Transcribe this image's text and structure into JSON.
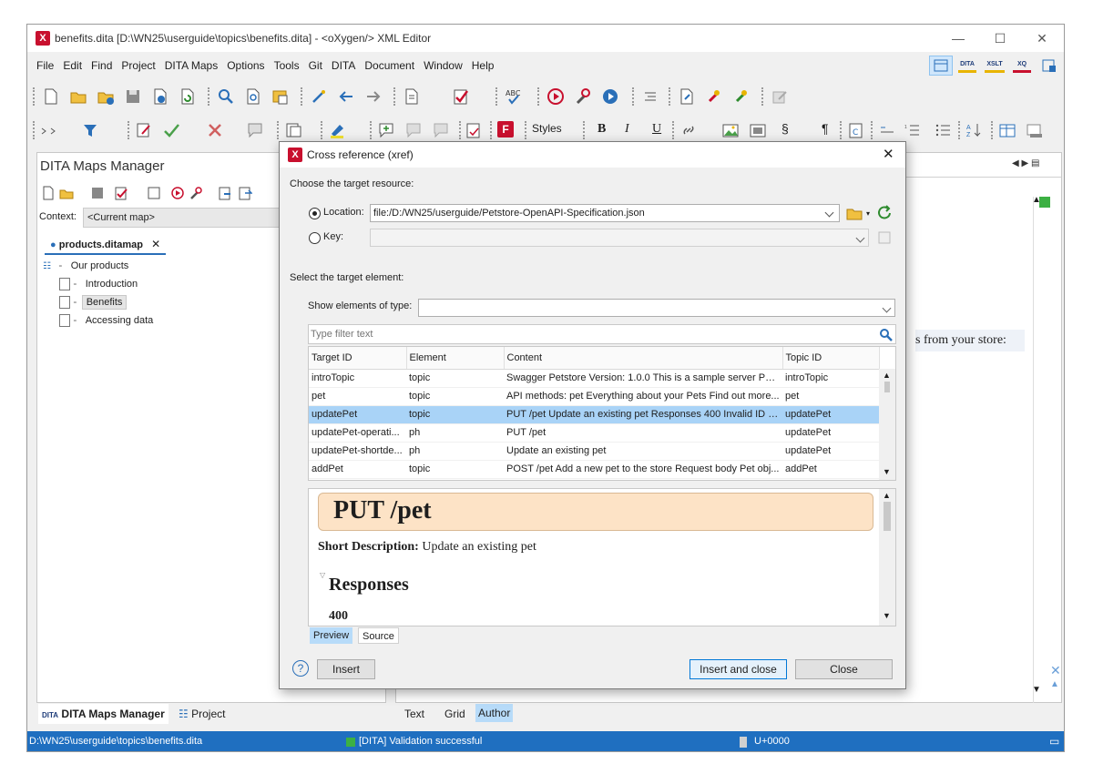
{
  "window": {
    "title": "benefits.dita [D:\\WN25\\userguide\\topics\\benefits.dita] - <oXygen/> XML Editor",
    "app_icon": "X",
    "controls": [
      "—",
      "☐",
      "✕"
    ]
  },
  "menu": [
    "File",
    "Edit",
    "Find",
    "Project",
    "DITA Maps",
    "Options",
    "Tools",
    "Git",
    "DITA",
    "Document",
    "Window",
    "Help"
  ],
  "toolbar": {
    "styles_label": "Styles",
    "bold": "B",
    "italic": "I",
    "underline": "U",
    "section": "§",
    "pilcrow": "¶"
  },
  "perspectives": [
    "",
    "DITA",
    "XSLT",
    "XQ",
    ""
  ],
  "left_panel": {
    "title": "DITA Maps Manager",
    "context_label": "Context:",
    "context_value": "<Current map>",
    "map_tab": "products.ditamap",
    "tree": [
      {
        "label": "Our products",
        "level": 0
      },
      {
        "label": "Introduction",
        "level": 1
      },
      {
        "label": "Benefits",
        "level": 1,
        "selected": true
      },
      {
        "label": "Accessing data",
        "level": 1
      }
    ],
    "bottom_tabs": [
      "DITA Maps Manager",
      "Project"
    ]
  },
  "editor": {
    "partial_text": "s from your store:",
    "mode_tabs": [
      "Text",
      "Grid",
      "Author"
    ],
    "active_mode": "Author"
  },
  "statusbar": {
    "path": "D:\\WN25\\userguide\\topics\\benefits.dita",
    "validation": "[DITA] Validation successful",
    "unicode": "U+0000"
  },
  "dialog": {
    "title": "Cross reference (xref)",
    "choose_resource": "Choose the target resource:",
    "location_label": "Location:",
    "location_value": "file:/D:/WN25/userguide/Petstore-OpenAPI-Specification.json",
    "key_label": "Key:",
    "select_element": "Select the target element:",
    "show_elements_label": "Show elements of type:",
    "filter_placeholder": "Type filter text",
    "columns": [
      "Target ID",
      "Element",
      "Content",
      "Topic ID"
    ],
    "rows": [
      {
        "target": "introTopic",
        "element": "topic",
        "content": "Swagger Petstore Version: 1.0.0 This is a sample server Pet...",
        "topic": "introTopic"
      },
      {
        "target": "pet",
        "element": "topic",
        "content": "API methods: pet Everything about your Pets Find out more...",
        "topic": "pet"
      },
      {
        "target": "updatePet",
        "element": "topic",
        "content": "PUT /pet Update an existing pet Responses 400 Invalid ID s...",
        "topic": "updatePet",
        "selected": true
      },
      {
        "target": "updatePet-operati...",
        "element": "ph",
        "content": "PUT /pet",
        "topic": "updatePet"
      },
      {
        "target": "updatePet-shortde...",
        "element": "ph",
        "content": "Update an existing pet",
        "topic": "updatePet"
      },
      {
        "target": "addPet",
        "element": "topic",
        "content": "POST /pet Add a new pet to the store Request body Pet obj...",
        "topic": "addPet"
      }
    ],
    "preview": {
      "heading": "PUT /pet",
      "short_desc_label": "Short Description:",
      "short_desc_value": "Update an existing pet",
      "section_title": "Responses",
      "code": "400"
    },
    "preview_tabs": [
      "Preview",
      "Source"
    ],
    "buttons": {
      "help": "?",
      "insert": "Insert",
      "insert_close": "Insert and close",
      "close": "Close"
    }
  }
}
